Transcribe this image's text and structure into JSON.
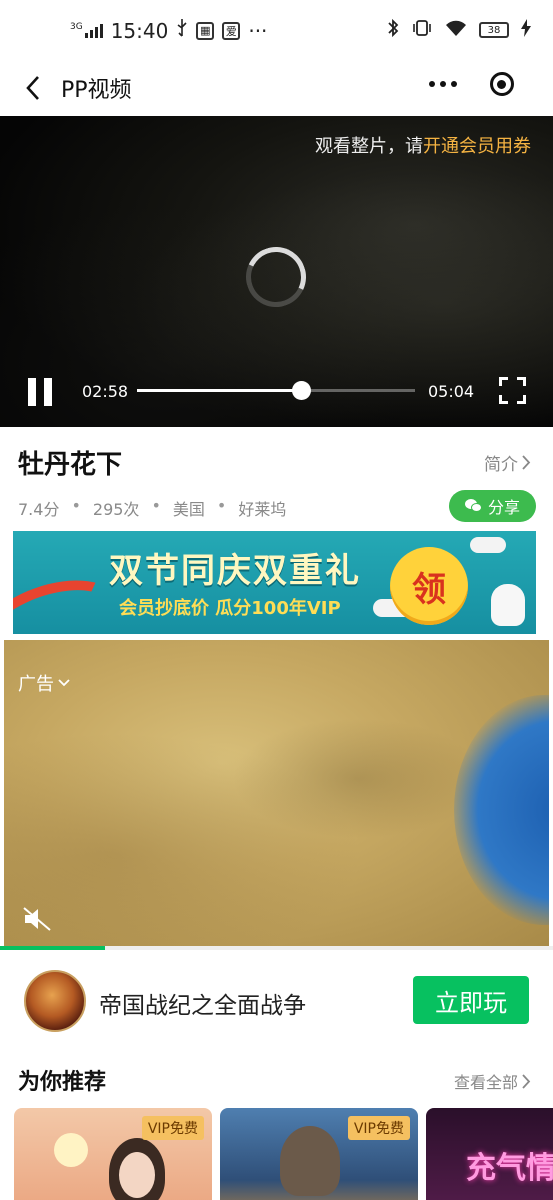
{
  "status_bar": {
    "network": "3G",
    "time": "15:40",
    "overflow": "···",
    "battery": "38",
    "icons": [
      "usb-icon",
      "notification-icon",
      "bluetooth-icon",
      "vibrate-icon",
      "wifi-icon",
      "charging-icon"
    ]
  },
  "nav": {
    "back_icon": "chevron-left-icon",
    "title": "PP视频",
    "menu_icon": "more-dots-icon",
    "close_icon": "target-icon"
  },
  "player": {
    "notice_prefix": "观看整片，请",
    "notice_highlight": "开通会员用券",
    "highlight_color": "#f5b342",
    "current_time": "02:58",
    "total_time": "05:04",
    "progress": 0.59,
    "state": "playing"
  },
  "video": {
    "title": "牡丹花下",
    "intro_label": "简介",
    "meta": [
      "7.4分",
      "295次",
      "美国",
      "好莱坞"
    ],
    "meta_separator": "•",
    "share_label": "分享",
    "share_color": "#3dbb4e"
  },
  "promo": {
    "title": "双节同庆双重礼",
    "subtitle": "会员抄底价  瓜分100年VIP",
    "coin_label": "领"
  },
  "ad": {
    "label": "广告",
    "progress": 0.19,
    "accent": "#07c160"
  },
  "game": {
    "name": "帝国战纪之全面战争",
    "play_label": "立即玩"
  },
  "recommend": {
    "title": "为你推荐",
    "view_all": "查看全部",
    "cards": [
      {
        "badge": "VIP免费"
      },
      {
        "badge": "VIP免费"
      },
      {
        "neon_text": "充气情"
      }
    ]
  }
}
